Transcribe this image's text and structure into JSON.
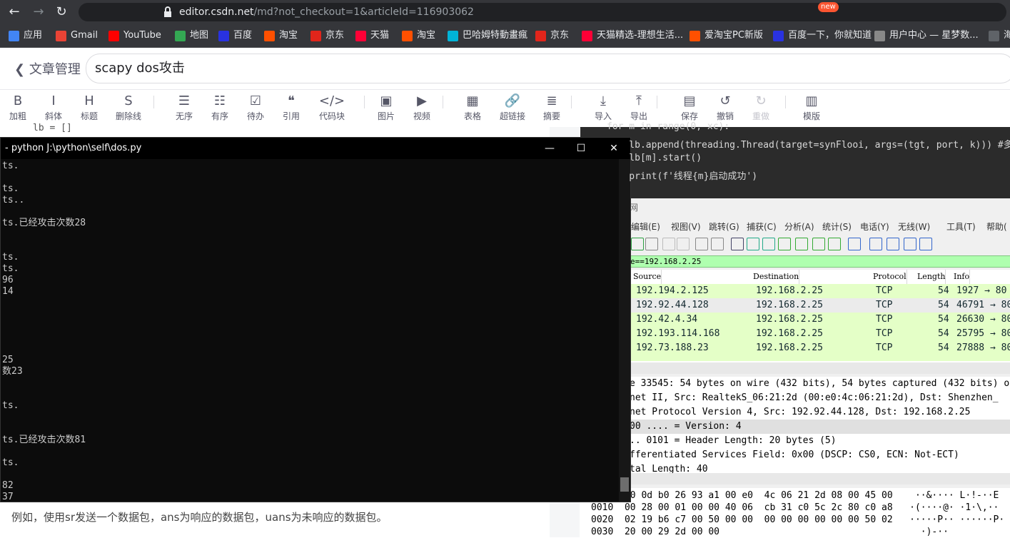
{
  "browser": {
    "url_host": "editor.csdn.net",
    "url_path": "/md?not_checkout=1&articleId=116903062",
    "bookmarks": [
      {
        "label": "应用",
        "icon": "apps-grid-icon",
        "color": "#4285f4"
      },
      {
        "label": "Gmail",
        "icon": "gmail-icon",
        "color": "#ea4335"
      },
      {
        "label": "YouTube",
        "icon": "youtube-icon",
        "color": "#ff0000"
      },
      {
        "label": "地图",
        "icon": "maps-pin-icon",
        "color": "#34a853"
      },
      {
        "label": "百度",
        "icon": "baidu-paw-icon",
        "color": "#2932e1"
      },
      {
        "label": "淘宝",
        "icon": "taobao-icon",
        "color": "#ff5000"
      },
      {
        "label": "京东",
        "icon": "jd-icon",
        "color": "#e1251b"
      },
      {
        "label": "天猫",
        "icon": "tmall-icon",
        "color": "#ff0036"
      },
      {
        "label": "淘宝",
        "icon": "taobao-icon",
        "color": "#ff5000"
      },
      {
        "label": "巴哈姆特動畫瘋",
        "icon": "bahamut-icon",
        "color": "#00b4d8"
      },
      {
        "label": "京东",
        "icon": "jd-icon",
        "color": "#e1251b"
      },
      {
        "label": "天猫精选-理想生活...",
        "icon": "tmall-icon",
        "color": "#ff0036"
      },
      {
        "label": "爱淘宝PC新版",
        "icon": "taobao-icon",
        "color": "#ff5000"
      },
      {
        "label": "百度一下，你就知道",
        "icon": "baidu-paw-icon",
        "color": "#2932e1"
      },
      {
        "label": "用户中心 — 星梦数...",
        "icon": "user-center-icon",
        "color": "#888888"
      },
      {
        "label": "海",
        "icon": "globe-icon",
        "color": "#5f6368"
      }
    ]
  },
  "editor": {
    "back_label": "文章管理",
    "article_title": "scapy dos攻击",
    "toolbar": [
      {
        "icon": "bold-icon",
        "glyph": "B",
        "label": "加粗"
      },
      {
        "icon": "italic-icon",
        "glyph": "I",
        "label": "斜体"
      },
      {
        "icon": "heading-icon",
        "glyph": "H",
        "label": "标题"
      },
      {
        "icon": "strikethrough-icon",
        "glyph": "S",
        "label": "删除线"
      },
      {
        "icon": "unordered-list-icon",
        "glyph": "☰",
        "label": "无序"
      },
      {
        "icon": "ordered-list-icon",
        "glyph": "☷",
        "label": "有序"
      },
      {
        "icon": "todo-list-icon",
        "glyph": "☑",
        "label": "待办"
      },
      {
        "icon": "quote-icon",
        "glyph": "❝",
        "label": "引用"
      },
      {
        "icon": "code-block-icon",
        "glyph": "</>",
        "label": "代码块"
      },
      {
        "icon": "image-icon",
        "glyph": "▣",
        "label": "图片"
      },
      {
        "icon": "video-icon",
        "glyph": "▶",
        "label": "视频"
      },
      {
        "icon": "table-icon",
        "glyph": "▦",
        "label": "表格"
      },
      {
        "icon": "link-icon",
        "glyph": "🔗",
        "label": "超链接"
      },
      {
        "icon": "summary-icon",
        "glyph": "≣",
        "label": "摘要"
      },
      {
        "icon": "import-icon",
        "glyph": "⤓",
        "label": "导入"
      },
      {
        "icon": "export-icon",
        "glyph": "⤒",
        "label": "导出"
      },
      {
        "icon": "save-icon",
        "glyph": "▤",
        "label": "保存"
      },
      {
        "icon": "undo-icon",
        "glyph": "↺",
        "label": "撤销"
      },
      {
        "icon": "redo-icon",
        "glyph": "↻",
        "label": "重做"
      },
      {
        "icon": "template-icon",
        "glyph": "▥",
        "label": "模版"
      }
    ],
    "new_badge": "new",
    "md_peek": "lb = []",
    "bottom_text": "例如，使用sr发送一个数据包，ans为响应的数据包，uans为未响应的数据包。",
    "code_lines": [
      "for m in range(0, xc):",
      "    lb.append(threading.Thread(target=synFlooi, args=(tgt, port, k))) #多",
      "    lb[m].start()",
      "    print(f'线程{m}启动成功')"
    ]
  },
  "console": {
    "title": "- python  J:\\python\\self\\dos.py",
    "lines": [
      "ts.",
      "",
      "ts.",
      "ts..",
      "",
      "ts.已经攻击次数28",
      "",
      "",
      "ts.",
      "ts.",
      "96",
      "14",
      "",
      "",
      "",
      "",
      "",
      "25",
      "数23",
      "",
      "",
      "ts.",
      "",
      "",
      "ts.已经攻击次数81",
      "",
      "ts.",
      "",
      "82",
      "37"
    ]
  },
  "wireshark": {
    "title_fragment": "网",
    "menu": [
      "编辑(E)",
      "视图(V)",
      "跳转(G)",
      "捕获(C)",
      "分析(A)",
      "统计(S)",
      "电话(Y)",
      "无线(W)",
      "工具(T)",
      "帮助("
    ],
    "filter": "e==192.168.2.25",
    "columns": [
      "Source",
      "Destination",
      "Protocol",
      "Length",
      "Info"
    ],
    "packets": [
      {
        "source": "192.194.2.125",
        "destination": "192.168.2.25",
        "protocol": "TCP",
        "length": "54",
        "info": "1927 → 80"
      },
      {
        "source": "192.92.44.128",
        "destination": "192.168.2.25",
        "protocol": "TCP",
        "length": "54",
        "info": "46791 → 80"
      },
      {
        "source": "192.42.4.34",
        "destination": "192.168.2.25",
        "protocol": "TCP",
        "length": "54",
        "info": "26630 → 80"
      },
      {
        "source": "192.193.114.168",
        "destination": "192.168.2.25",
        "protocol": "TCP",
        "length": "54",
        "info": "25795 → 80"
      },
      {
        "source": "192.73.188.23",
        "destination": "192.168.2.25",
        "protocol": "TCP",
        "length": "54",
        "info": "27888 → 80"
      }
    ],
    "details": [
      "e 33545: 54 bytes on wire (432 bits), 54 bytes captured (432 bits) o",
      "net II, Src: RealtekS_06:21:2d (00:e0:4c:06:21:2d), Dst: Shenzhen_",
      "net Protocol Version 4, Src: 192.92.44.128, Dst: 192.168.2.25",
      "00 .... = Version: 4",
      ".. 0101 = Header Length: 20 bytes (5)",
      "fferentiated Services Field: 0x00 (DSCP: CS0, ECN: Not-ECT)",
      "tal Length: 40"
    ],
    "hex": [
      "      20 0d b0 26 93 a1 00 e0  4c 06 21 2d 08 00 45 00    ··&···· L·!-··E",
      "0010  00 28 00 01 00 00 40 06  cb 31 c0 5c 2c 80 c0 a8   ·(····@· ·1·\\,··",
      "0020  02 19 b6 c7 00 50 00 00  00 00 00 00 00 00 50 02   ·····P·· ······P·",
      "0030  20 00 29 2d 00 00                                    ·)-··"
    ]
  }
}
